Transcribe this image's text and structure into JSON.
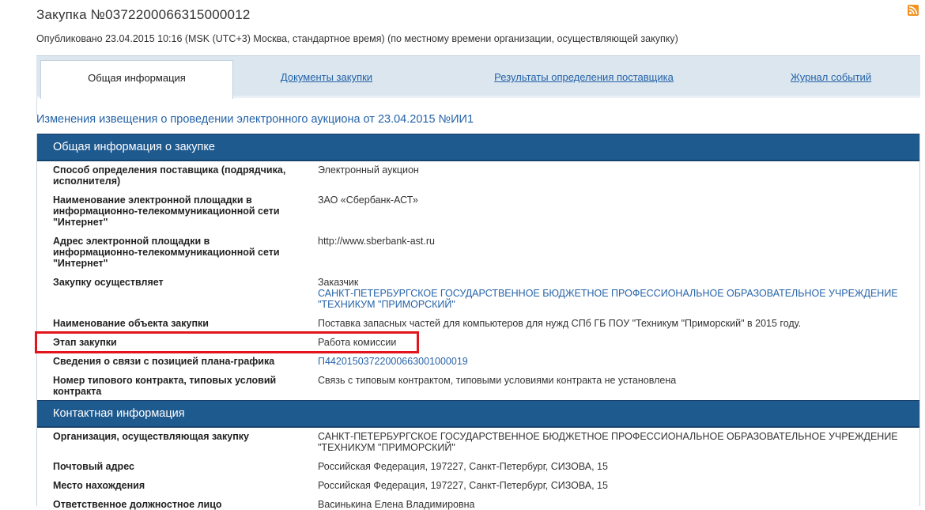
{
  "header": {
    "title": "Закупка №0372200066315000012",
    "published": "Опубликовано 23.04.2015 10:16 (MSK (UTC+3) Москва, стандартное время) (по местному времени организации, осуществляющей закупку)"
  },
  "tabs": [
    {
      "label": "Общая информация"
    },
    {
      "label": "Документы закупки"
    },
    {
      "label": "Результаты определения поставщика"
    },
    {
      "label": "Журнал событий"
    }
  ],
  "notice_link": "Изменения извещения о проведении электронного аукциона от 23.04.2015 №ИИ1",
  "general": {
    "header": "Общая информация о закупке",
    "rows": [
      {
        "label": "Способ определения поставщика (подрядчика, исполнителя)",
        "value": "Электронный аукцион"
      },
      {
        "label": "Наименование электронной площадки в информационно-телекоммуникационной сети \"Интернет\"",
        "value": "ЗАО «Сбербанк-АСТ»"
      },
      {
        "label": "Адрес электронной площадки в информационно-телекоммуникационной сети \"Интернет\"",
        "value": "http://www.sberbank-ast.ru"
      },
      {
        "label": "Закупку осуществляет",
        "value": "Заказчик",
        "value_link": "САНКТ-ПЕТЕРБУРГСКОЕ ГОСУДАРСТВЕННОЕ БЮДЖЕТНОЕ ПРОФЕССИОНАЛЬНОЕ ОБРАЗОВАТЕЛЬНОЕ УЧРЕЖДЕНИЕ \"ТЕХНИКУМ \"ПРИМОРСКИЙ\""
      },
      {
        "label": "Наименование объекта закупки",
        "value": "Поставка запасных частей для компьютеров для нужд СПб ГБ ПОУ \"Техникум \"Приморский\" в 2015 году."
      },
      {
        "label": "Этап закупки",
        "value": "Работа комиссии"
      },
      {
        "label": "Сведения о связи с позицией плана-графика",
        "value": "П44201503722000663001000019"
      },
      {
        "label": "Номер типового контракта, типовых условий контракта",
        "value": "Связь с типовым контрактом, типовыми условиями контракта не установлена"
      }
    ]
  },
  "contacts": {
    "header": "Контактная информация",
    "rows": [
      {
        "label": "Организация, осуществляющая закупку",
        "value": "САНКТ-ПЕТЕРБУРГСКОЕ ГОСУДАРСТВЕННОЕ БЮДЖЕТНОЕ ПРОФЕССИОНАЛЬНОЕ ОБРАЗОВАТЕЛЬНОЕ УЧРЕЖДЕНИЕ \"ТЕХНИКУМ \"ПРИМОРСКИЙ\""
      },
      {
        "label": "Почтовый адрес",
        "value": "Российская Федерация, 197227, Санкт-Петербург, СИЗОВА, 15"
      },
      {
        "label": "Место нахождения",
        "value": "Российская Федерация, 197227, Санкт-Петербург, СИЗОВА, 15"
      },
      {
        "label": "Ответственное должностное лицо",
        "value": "Васинькина Елена Владимировна"
      }
    ]
  },
  "colors": {
    "section_header": "#1f5a8f",
    "link": "#2563a8",
    "highlight": "#e3141b"
  }
}
